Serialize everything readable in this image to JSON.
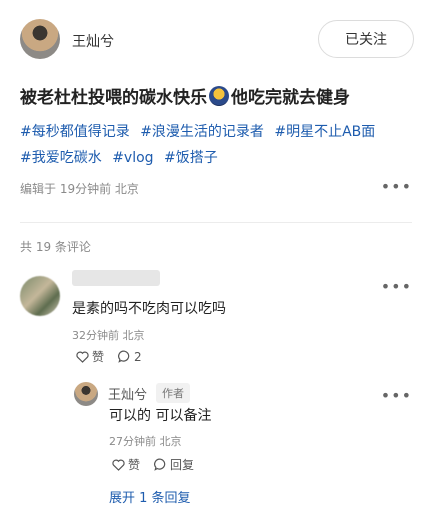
{
  "author": {
    "name": "王灿兮",
    "follow_label": "已关注"
  },
  "post": {
    "title_part1": "被老杜杜投喂的碳水快乐",
    "emoji": "badge-emoji",
    "title_part2": "他吃完就去健身",
    "tags": [
      "#每秒都值得记录",
      "#浪漫生活的记录者",
      "#明星不止AB面",
      "#我爱吃碳水",
      "#vlog",
      "#饭搭子"
    ],
    "edited": "编辑于 19分钟前 北京",
    "more_icon": "more-dots-icon"
  },
  "comments": {
    "count_label": "共 19 条评论",
    "items": [
      {
        "text": "是素的吗不吃肉可以吃吗",
        "time": "32分钟前 北京",
        "like_label": "赞",
        "reply_count": "2",
        "like_icon": "heart-icon",
        "reply_icon": "comment-bubble-icon"
      }
    ],
    "reply": {
      "name": "王灿兮",
      "badge": "作者",
      "text": "可以的 可以备注",
      "time": "27分钟前 北京",
      "like_label": "赞",
      "reply_label": "回复"
    },
    "expand_label": "展开 1 条回复"
  }
}
